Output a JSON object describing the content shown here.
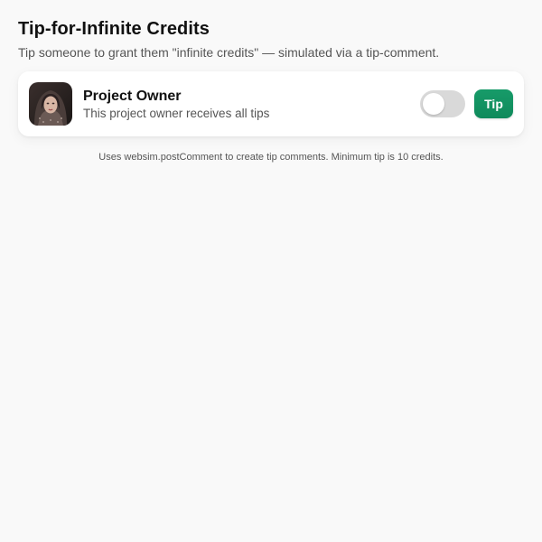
{
  "header": {
    "title": "Tip-for-Infinite Credits",
    "subtitle": "Tip someone to grant them \"infinite credits\" — simulated via a tip-comment."
  },
  "owner_card": {
    "avatar_icon": "avatar-photo",
    "name": "Project Owner",
    "description": "This project owner receives all tips",
    "toggle_state": "off",
    "tip_label": "Tip"
  },
  "footer": {
    "note": "Uses websim.postComment to create tip comments. Minimum tip is 10 credits."
  },
  "colors": {
    "background": "#f9f9f9",
    "card": "#ffffff",
    "accent": "#0f8a5b",
    "toggle_off": "#d9d9d9"
  }
}
